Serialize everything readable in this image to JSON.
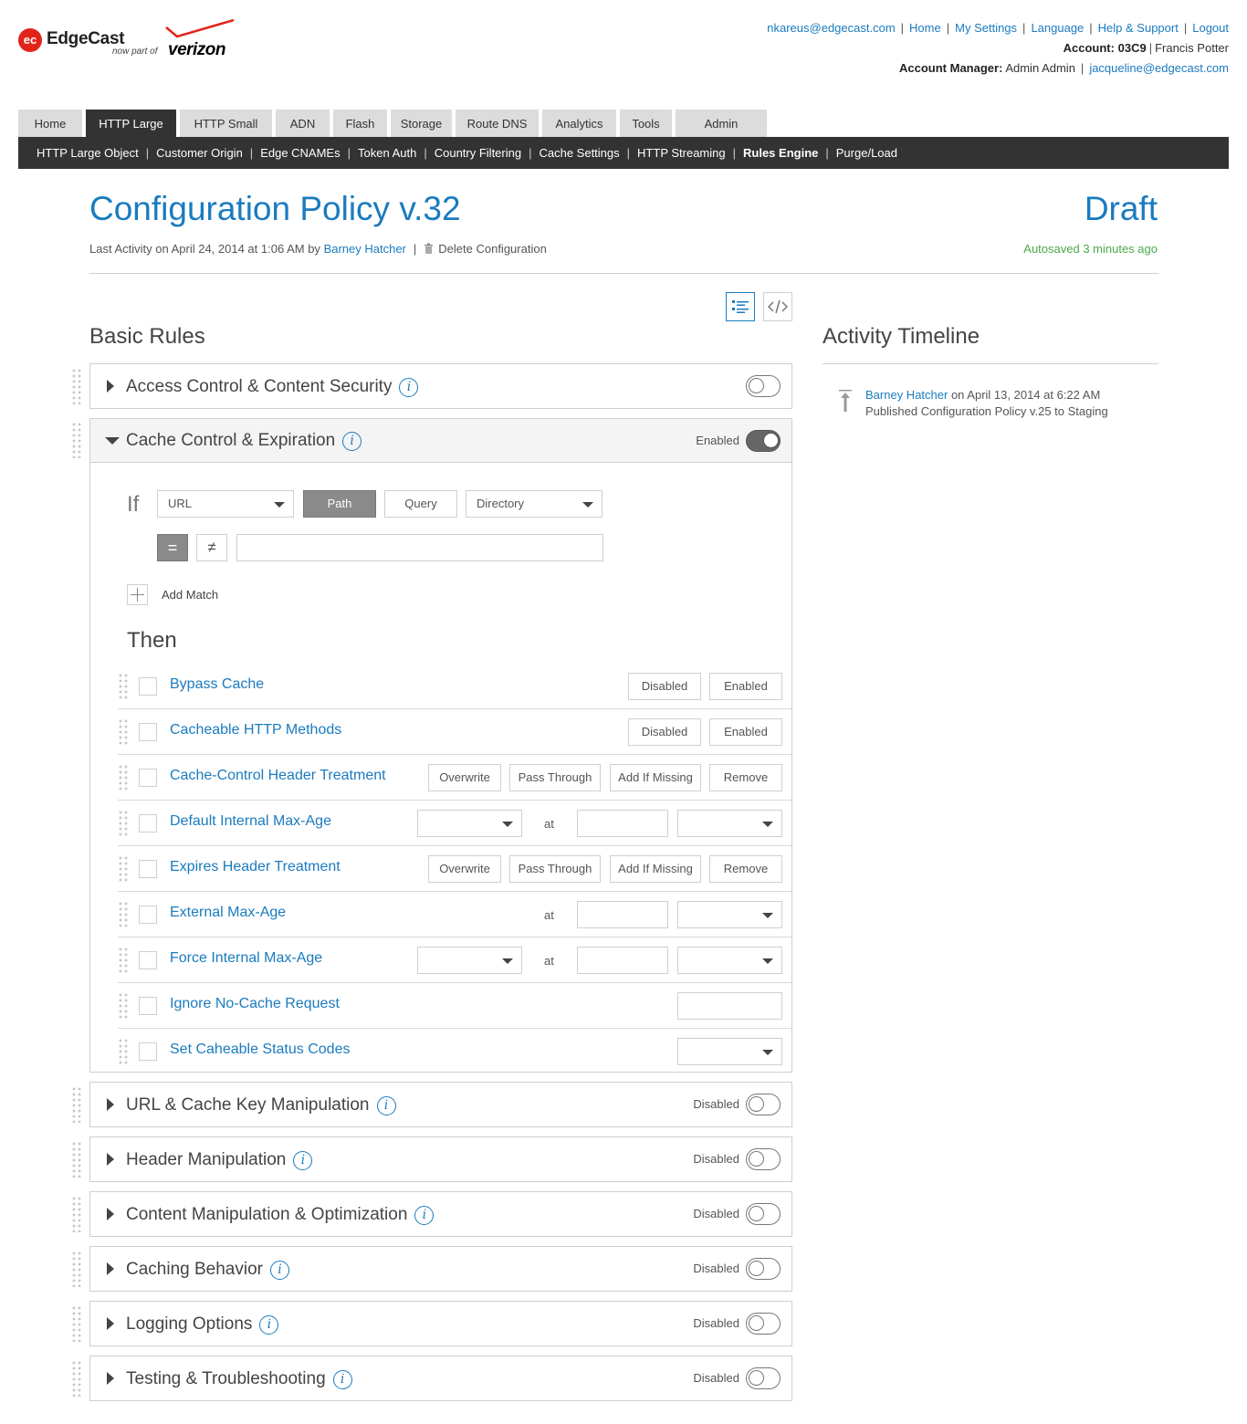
{
  "brand": {
    "logo_mark": "ec",
    "name": "EdgeCast",
    "tagline": "now part of",
    "partner": "verizon",
    "accent": "#e2231a"
  },
  "header": {
    "user_email": "nkareus@edgecast.com",
    "links": [
      "Home",
      "My Settings",
      "Language",
      "Help & Support",
      "Logout"
    ],
    "account_label": "Account:",
    "account_id": "03C9",
    "account_name": "Francis Potter",
    "manager_label": "Account Manager:",
    "manager_name": "Admin Admin",
    "manager_email": "jacqueline@edgecast.com"
  },
  "tabs": [
    {
      "label": "Home",
      "active": false
    },
    {
      "label": "HTTP Large",
      "active": true
    },
    {
      "label": "HTTP Small",
      "active": false
    },
    {
      "label": "ADN",
      "active": false
    },
    {
      "label": "Flash",
      "active": false
    },
    {
      "label": "Storage",
      "active": false
    },
    {
      "label": "Route DNS",
      "active": false
    },
    {
      "label": "Analytics",
      "active": false
    },
    {
      "label": "Tools",
      "active": false
    },
    {
      "label": "Admin",
      "active": false
    }
  ],
  "subnav": [
    "HTTP Large Object",
    "Customer Origin",
    "Edge CNAMEs",
    "Token Auth",
    "Country Filtering",
    "Cache Settings",
    "HTTP Streaming",
    "Rules Engine",
    "Purge/Load"
  ],
  "subnav_current": "Rules Engine",
  "page": {
    "title": "Configuration Policy v.32",
    "status": "Draft",
    "last_activity": "Last Activity on April 24, 2014 at 1:06 AM by",
    "last_user": "Barney Hatcher",
    "delete_label": "Delete Configuration",
    "autosaved": "Autosaved 3 minutes ago",
    "view_icons": [
      "list-view-icon",
      "code-view-icon"
    ]
  },
  "basic_rules": {
    "heading": "Basic Rules",
    "panels": [
      {
        "title": "Access Control & Content Security",
        "status": "",
        "enabled": false
      },
      {
        "title": "Cache Control & Expiration",
        "status": "Enabled",
        "enabled": true
      },
      {
        "title": "URL & Cache Key Manipulation",
        "status": "Disabled",
        "enabled": false
      },
      {
        "title": "Header Manipulation",
        "status": "Disabled",
        "enabled": false
      },
      {
        "title": "Content Manipulation & Optimization",
        "status": "Disabled",
        "enabled": false
      },
      {
        "title": "Caching Behavior",
        "status": "Disabled",
        "enabled": false
      },
      {
        "title": "Logging Options",
        "status": "Disabled",
        "enabled": false
      },
      {
        "title": "Testing & Troubleshooting",
        "status": "Disabled",
        "enabled": false
      }
    ]
  },
  "condition": {
    "if_label": "If",
    "field_select": "URL",
    "part_buttons": [
      "Path",
      "Query"
    ],
    "part_selected": "Path",
    "scope_select": "Directory",
    "op_equal": "=",
    "op_not_equal": "≠",
    "op_selected": "=",
    "value": "",
    "add_match": "Add Match",
    "then_label": "Then"
  },
  "features": {
    "at_label": "at",
    "items": [
      {
        "name": "Bypass Cache",
        "buttons": [
          "Disabled",
          "Enabled"
        ]
      },
      {
        "name": "Cacheable HTTP Methods",
        "buttons": [
          "Disabled",
          "Enabled"
        ]
      },
      {
        "name": "Cache-Control Header Treatment",
        "buttons": [
          "Overwrite",
          "Pass Through",
          "Add If Missing",
          "Remove"
        ]
      },
      {
        "name": "Default Internal Max-Age"
      },
      {
        "name": "Expires Header Treatment",
        "buttons": [
          "Overwrite",
          "Pass Through",
          "Add If Missing",
          "Remove"
        ]
      },
      {
        "name": "External Max-Age"
      },
      {
        "name": "Force Internal Max-Age"
      },
      {
        "name": "Ignore No-Cache Request"
      },
      {
        "name": "Set Caheable Status Codes"
      }
    ]
  },
  "activity": {
    "heading": "Activity Timeline",
    "items": [
      {
        "user": "Barney Hatcher",
        "when": "on April 13, 2014 at 6:22 AM",
        "text": "Published Configuration Policy v.25 to Staging",
        "icon": "publish-icon"
      }
    ]
  }
}
